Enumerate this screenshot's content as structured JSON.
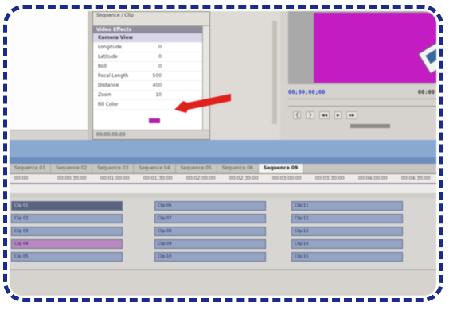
{
  "effect_controls": {
    "header": "Sequence / Clip",
    "section": "Video Effects",
    "effect_name": "Camera View",
    "rows": [
      {
        "label": "Longitude",
        "value": "0"
      },
      {
        "label": "Latitude",
        "value": "0"
      },
      {
        "label": "Roll",
        "value": "0"
      },
      {
        "label": "Focal Length",
        "value": "500"
      },
      {
        "label": "Distance",
        "value": "400"
      },
      {
        "label": "Zoom",
        "value": "10"
      },
      {
        "label": "Fill Color",
        "value": ""
      }
    ],
    "timecode": "00;00;00;00",
    "fill_color": "#b021a8"
  },
  "monitor": {
    "timecode": "00;00;00;00",
    "duration": "00:00",
    "background_color": "#c21cc2"
  },
  "timeline": {
    "tabs": [
      "Sequence 01",
      "Sequence 02",
      "Sequence 03",
      "Sequence 04",
      "Sequence 05",
      "Sequence 06",
      "Sequence 07",
      "Sequence 08"
    ],
    "active_tab": "Sequence 09",
    "ruler": [
      "00;00",
      "00;00;30;00",
      "00;01;00;00",
      "00;01;30;00",
      "00;02;00;00",
      "00;02;30;00",
      "00;03;00;00",
      "00;03;30;00",
      "00;04;00;00",
      "00;04;30;00"
    ],
    "clips_col1": [
      "Clip 01",
      "Clip 02",
      "Clip 03",
      "Clip 04",
      "Clip 05"
    ],
    "clips_col2": [
      "Clip 06",
      "Clip 07",
      "Clip 08",
      "Clip 09",
      "Clip 10"
    ],
    "clips_col3": [
      "Clip 11",
      "Clip 12",
      "Clip 13",
      "Clip 14",
      "Clip 15"
    ]
  },
  "colors": {
    "frame_border": "#1a2b8c",
    "arrow": "#e0201a"
  }
}
